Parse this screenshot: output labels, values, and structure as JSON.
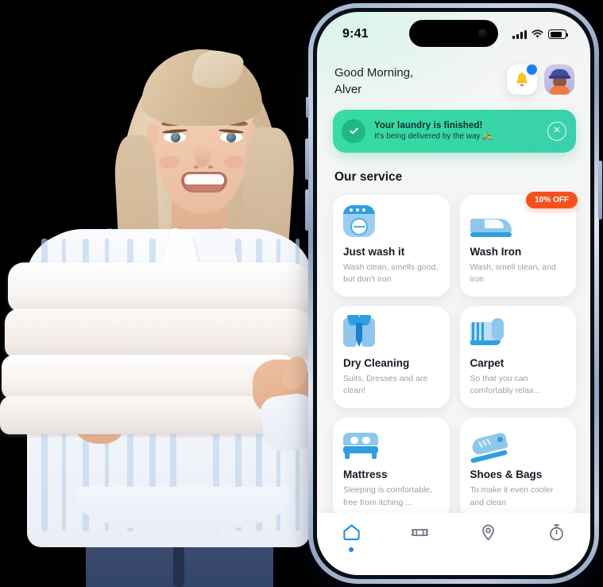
{
  "photo": {
    "alt": "Smiling blonde woman holding a stack of folded white towels, wearing a white and blue striped shirt and blue jeans"
  },
  "phone": {
    "status_bar": {
      "time": "9:41",
      "signal_icon": "cellular-bars-icon",
      "wifi_icon": "wifi-icon",
      "battery_icon": "battery-icon",
      "dynamic_island": "dynamic-island"
    },
    "header": {
      "greeting_line1": "Good Morning,",
      "greeting_line2": "Alver",
      "bell_icon": "bell-icon",
      "notification_dot_color": "#1b7ef0",
      "avatar_icon": "user-avatar"
    },
    "banner": {
      "title": "Your laundry is finished!",
      "subtitle": "It's being delivered by the way 🛵",
      "check_icon": "check-circle-icon",
      "close_icon": "close-circle-icon",
      "bg_color": "#37dca0"
    },
    "section": {
      "title": "Our service"
    },
    "services": [
      {
        "icon": "washing-machine-icon",
        "title": "Just wash it",
        "desc": "Wash clean, smells good, but don't iron",
        "badge": null
      },
      {
        "icon": "iron-icon",
        "title": "Wash Iron",
        "desc": "Wash, smell clean, and iron",
        "badge": "10% OFF",
        "badge_color": "#f6511d"
      },
      {
        "icon": "dress-shirt-tie-icon",
        "title": "Dry Cleaning",
        "desc": "Suits, Dresses and are clean!",
        "badge": null
      },
      {
        "icon": "carpet-roll-icon",
        "title": "Carpet",
        "desc": "So that you can comfortably relax...",
        "badge": null
      },
      {
        "icon": "mattress-bed-icon",
        "title": "Mattress",
        "desc": "Sleeping is comfortable, free from itching ...",
        "badge": null
      },
      {
        "icon": "shoe-icon",
        "title": "Shoes & Bags",
        "desc": "To make it even cooler and clean",
        "badge": null
      }
    ],
    "tabbar": {
      "active_color": "#1b8ae8",
      "inactive_color": "#6b7280",
      "items": [
        {
          "icon": "home-icon",
          "active": true
        },
        {
          "icon": "ticket-icon",
          "active": false
        },
        {
          "icon": "location-pin-icon",
          "active": false
        },
        {
          "icon": "stopwatch-icon",
          "active": false
        }
      ]
    }
  }
}
